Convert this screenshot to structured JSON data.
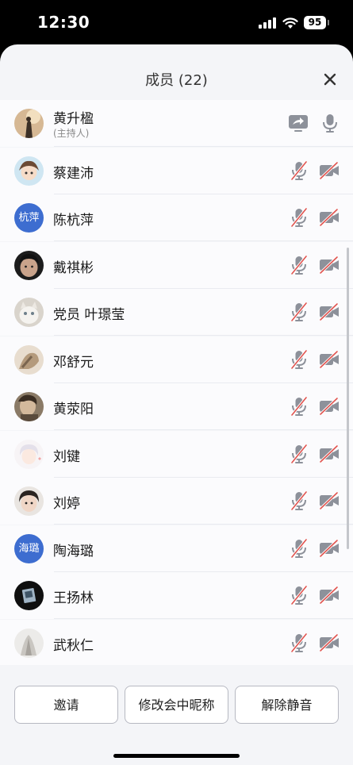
{
  "status": {
    "time": "12:30",
    "battery": "95"
  },
  "header": {
    "title": "成员 (22)"
  },
  "host": {
    "name": "黄升楹",
    "role": "(主持人)"
  },
  "members": [
    {
      "name": "蔡建沛"
    },
    {
      "name": "陈杭萍",
      "avatar_text": "杭萍"
    },
    {
      "name": "戴祺彬"
    },
    {
      "name": "党员 叶璟莹"
    },
    {
      "name": "邓舒元"
    },
    {
      "name": "黄荥阳"
    },
    {
      "name": "刘键"
    },
    {
      "name": "刘婷"
    },
    {
      "name": "陶海璐",
      "avatar_text": "海璐"
    },
    {
      "name": "王扬林"
    },
    {
      "name": "武秋仁"
    }
  ],
  "actions": {
    "invite": "邀请",
    "rename": "修改会中昵称",
    "unmute": "解除静音"
  },
  "colors": {
    "accent_avatar": "#3d6dd0",
    "muted_slash": "#e0534f"
  }
}
